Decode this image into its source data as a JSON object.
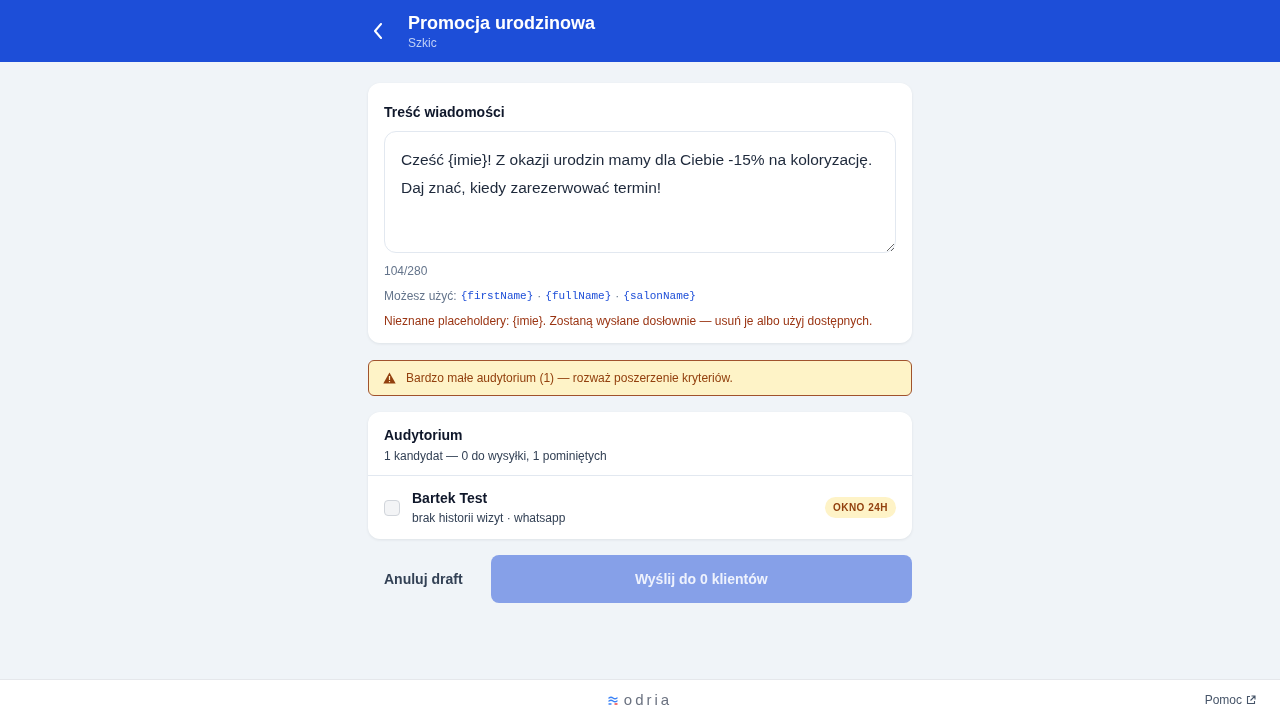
{
  "header": {
    "title": "Promocja urodzinowa",
    "subtitle": "Szkic"
  },
  "message": {
    "title": "Treść wiadomości",
    "value": "Cześć {imie}! Z okazji urodzin mamy dla Ciebie -15% na koloryzację. Daj znać, kiedy zarezerwować termin!",
    "counter": "104/280",
    "hint": {
      "label": "Możesz użyć:",
      "separator": "·",
      "tokens": [
        "{firstName}",
        "{fullName}",
        "{salonName}"
      ]
    },
    "error": "Nieznane placeholdery: {imie}. Zostaną wysłane dosłownie — usuń je albo użyj dostępnych."
  },
  "warning": {
    "text": "Bardzo małe audytorium (1) — rozważ poszerzenie kryteriów."
  },
  "audience": {
    "title": "Audytorium",
    "summary": "1 kandydat — 0 do wysyłki, 1 pominiętych",
    "recipients": [
      {
        "name": "Bartek Test",
        "meta": "brak historii wizyt · whatsapp",
        "checked": false,
        "disabled": true,
        "badge": "OKNO 24H"
      }
    ]
  },
  "actions": {
    "cancel": "Anuluj draft",
    "send": {
      "label": "Wyślij do 0 klientów",
      "disabled": true
    }
  },
  "footer": {
    "logo": "odria",
    "help": "Pomoc"
  }
}
